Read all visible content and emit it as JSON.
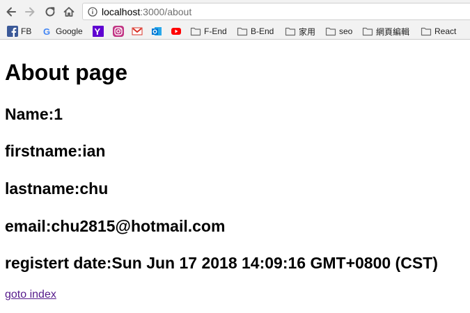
{
  "browser": {
    "url_host": "localhost",
    "url_path": ":3000/about",
    "nav_icons": [
      "back-icon",
      "forward-icon",
      "reload-icon",
      "home-icon"
    ]
  },
  "bookmarks": [
    {
      "label": "FB",
      "icon": "facebook-icon",
      "color": "#3b5998"
    },
    {
      "label": "Google",
      "icon": "google-icon",
      "color": "#4285f4"
    },
    {
      "label": "",
      "icon": "yahoo-icon",
      "color": "#5f01d1"
    },
    {
      "label": "",
      "icon": "instagram-icon",
      "color": "#c13584"
    },
    {
      "label": "",
      "icon": "gmail-icon",
      "color": "#d93025"
    },
    {
      "label": "",
      "icon": "outlook-icon",
      "color": "#0078d4"
    },
    {
      "label": "",
      "icon": "youtube-icon",
      "color": "#ff0000"
    },
    {
      "label": "F-End",
      "icon": "folder-icon"
    },
    {
      "label": "B-End",
      "icon": "folder-icon"
    },
    {
      "label": "家用",
      "icon": "folder-icon"
    },
    {
      "label": "seo",
      "icon": "folder-icon"
    },
    {
      "label": "網頁編輯",
      "icon": "folder-icon"
    },
    {
      "label": "React",
      "icon": "folder-icon"
    }
  ],
  "page": {
    "title": "About page",
    "fields": [
      "Name:1",
      "firstname:ian",
      "lastname:chu",
      "email:chu2815@hotmail.com",
      "registert date:Sun Jun 17 2018 14:09:16 GMT+0800 (CST)"
    ],
    "link_text": "goto index",
    "link_color": "#551a8b"
  }
}
